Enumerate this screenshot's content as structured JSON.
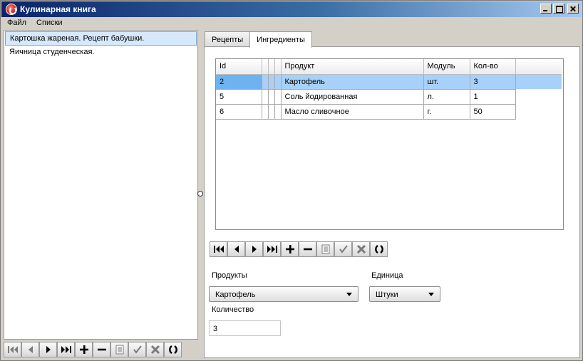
{
  "window": {
    "title": "Кулинарная книга"
  },
  "menu": [
    "Файл",
    "Списки"
  ],
  "recipes": [
    {
      "label": "Картошка жареная. Рецепт бабушки.",
      "selected": true
    },
    {
      "label": "Яичница студенческая.",
      "selected": false
    }
  ],
  "tabs": [
    {
      "label": "Рецепты",
      "active": false
    },
    {
      "label": "Ингредиенты",
      "active": true
    }
  ],
  "grid": {
    "columns": [
      "Id",
      "",
      "",
      "",
      "Продукт",
      "Модуль",
      "Кол-во"
    ],
    "rows": [
      {
        "id": "2",
        "product": "Картофель",
        "unit": "шт.",
        "qty": "3",
        "selected": true
      },
      {
        "id": "5",
        "product": "Соль йодированная",
        "unit": "л.",
        "qty": "1",
        "selected": false
      },
      {
        "id": "6",
        "product": "Масло сливочное",
        "unit": "г.",
        "qty": "50",
        "selected": false
      }
    ]
  },
  "navigator": {
    "buttons": [
      "first-icon",
      "prev-icon",
      "next-icon",
      "last-icon",
      "add-icon",
      "delete-icon",
      "edit-icon",
      "post-icon",
      "cancel-icon",
      "refresh-icon"
    ]
  },
  "form": {
    "products_label": "Продукты",
    "products_value": "Картофель",
    "unit_label": "Единица",
    "unit_value": "Штуки",
    "quantity_label": "Количество",
    "quantity_value": "3"
  }
}
